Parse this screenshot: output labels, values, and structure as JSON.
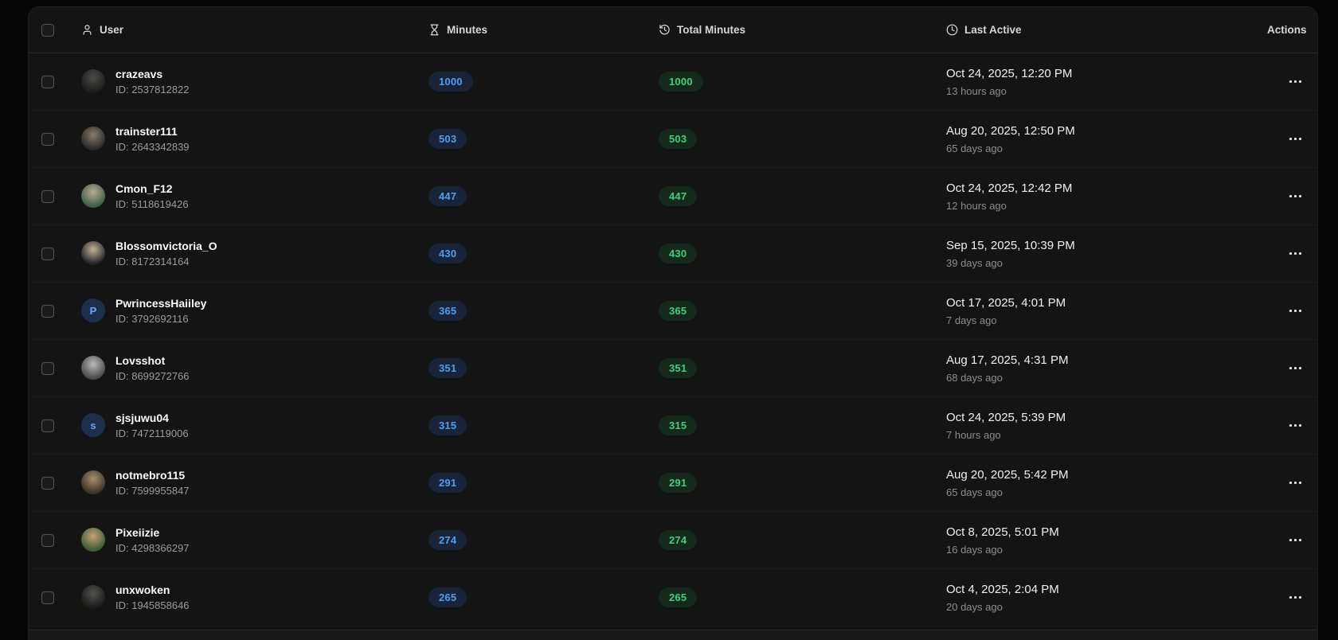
{
  "colors": {
    "page_bg": "#060606",
    "card_bg": "#141414",
    "minutes_badge_bg": "#1a2438",
    "minutes_badge_text": "#4f9ef0",
    "total_badge_bg": "#152a1c",
    "total_badge_text": "#3ecf7f",
    "initial_avatar_bg": "#1c2f4e",
    "initial_avatar_text": "#6ba3ea"
  },
  "table": {
    "columns": [
      {
        "label": "User",
        "icon": "user-icon"
      },
      {
        "label": "Minutes",
        "icon": "hourglass-icon"
      },
      {
        "label": "Total Minutes",
        "icon": "history-icon"
      },
      {
        "label": "Last Active",
        "icon": "clock-icon"
      },
      {
        "label": "Actions",
        "icon": null
      }
    ],
    "rows": [
      {
        "username": "crazeavs",
        "id_label": "ID: 2537812822",
        "minutes": "1000",
        "total_minutes": "1000",
        "last_active": "Oct 24, 2025, 12:20 PM",
        "relative": "13 hours ago",
        "avatar": {
          "type": "image",
          "colors": [
            "#4b4b49",
            "#1d1d1c"
          ]
        }
      },
      {
        "username": "trainster111",
        "id_label": "ID: 2643342839",
        "minutes": "503",
        "total_minutes": "503",
        "last_active": "Aug 20, 2025, 12:50 PM",
        "relative": "65 days ago",
        "avatar": {
          "type": "image",
          "colors": [
            "#8a7a64",
            "#2a2a2a"
          ]
        }
      },
      {
        "username": "Cmon_F12",
        "id_label": "ID: 5118619426",
        "minutes": "447",
        "total_minutes": "447",
        "last_active": "Oct 24, 2025, 12:42 PM",
        "relative": "12 hours ago",
        "avatar": {
          "type": "image",
          "colors": [
            "#b9ab8e",
            "#3f5f46"
          ]
        }
      },
      {
        "username": "Blossomvictoria_O",
        "id_label": "ID: 8172314164",
        "minutes": "430",
        "total_minutes": "430",
        "last_active": "Sep 15, 2025, 10:39 PM",
        "relative": "39 days ago",
        "avatar": {
          "type": "image",
          "colors": [
            "#c7b195",
            "#23232a"
          ]
        }
      },
      {
        "username": "PwrincessHaiiley",
        "id_label": "ID: 3792692116",
        "minutes": "365",
        "total_minutes": "365",
        "last_active": "Oct 17, 2025, 4:01 PM",
        "relative": "7 days ago",
        "avatar": {
          "type": "initial",
          "letter": "P",
          "bg": "#1c2f4e",
          "fg": "#6ba3ea"
        }
      },
      {
        "username": "Lovsshot",
        "id_label": "ID: 8699272766",
        "minutes": "351",
        "total_minutes": "351",
        "last_active": "Aug 17, 2025, 4:31 PM",
        "relative": "68 days ago",
        "avatar": {
          "type": "image",
          "colors": [
            "#b9b9b9",
            "#4a4a4a"
          ]
        }
      },
      {
        "username": "sjsjuwu04",
        "id_label": "ID: 7472119006",
        "minutes": "315",
        "total_minutes": "315",
        "last_active": "Oct 24, 2025, 5:39 PM",
        "relative": "7 hours ago",
        "avatar": {
          "type": "initial",
          "letter": "s",
          "bg": "#1c2f4e",
          "fg": "#6ba3ea"
        }
      },
      {
        "username": "notmebro115",
        "id_label": "ID: 7599955847",
        "minutes": "291",
        "total_minutes": "291",
        "last_active": "Aug 20, 2025, 5:42 PM",
        "relative": "65 days ago",
        "avatar": {
          "type": "image",
          "colors": [
            "#a88f6d",
            "#3a3329"
          ]
        }
      },
      {
        "username": "Pixeiizie",
        "id_label": "ID: 4298366297",
        "minutes": "274",
        "total_minutes": "274",
        "last_active": "Oct 8, 2025, 5:01 PM",
        "relative": "16 days ago",
        "avatar": {
          "type": "image",
          "colors": [
            "#c99f78",
            "#3c5c34"
          ]
        }
      },
      {
        "username": "unxwoken",
        "id_label": "ID: 1945858646",
        "minutes": "265",
        "total_minutes": "265",
        "last_active": "Oct 4, 2025, 2:04 PM",
        "relative": "20 days ago",
        "avatar": {
          "type": "image",
          "colors": [
            "#53534f",
            "#1b1b1a"
          ]
        }
      }
    ]
  }
}
